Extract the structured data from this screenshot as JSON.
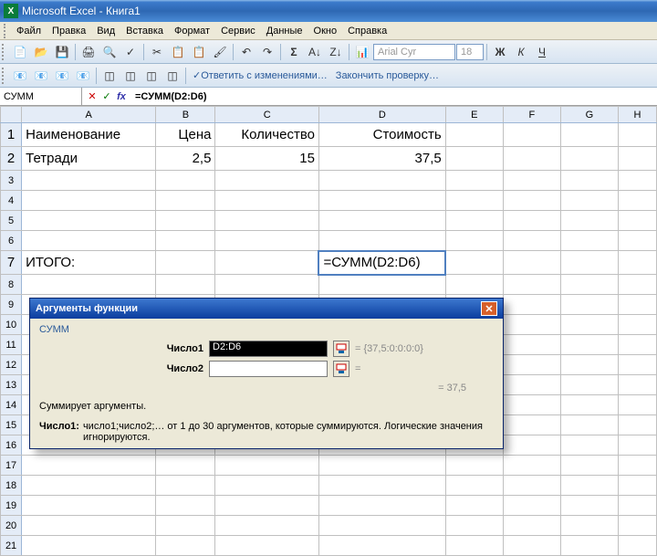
{
  "title": "Microsoft Excel - Книга1",
  "menu": {
    "file": "Файл",
    "edit": "Правка",
    "view": "Вид",
    "insert": "Вставка",
    "format": "Формат",
    "tools": "Сервис",
    "data": "Данные",
    "window": "Окно",
    "help": "Справка"
  },
  "toolbar2": {
    "font": "Arial Cyr",
    "size": "18",
    "review1": "Ответить с изменениями…",
    "review2": "Закончить проверку…"
  },
  "namebox": "СУММ",
  "formula": "=СУММ(D2:D6)",
  "columns": [
    "A",
    "B",
    "C",
    "D",
    "E",
    "F",
    "G",
    "H"
  ],
  "cells": {
    "A1": "Наименование",
    "B1": "Цена",
    "C1": "Количество",
    "D1": "Стоимость",
    "A2": "Тетради",
    "B2": "2,5",
    "C2": "15",
    "D2": "37,5",
    "A7": "ИТОГО:",
    "D7": "=СУММ(D2:D6)"
  },
  "dialog": {
    "title": "Аргументы функции",
    "func": "СУММ",
    "arg1_label": "Число1",
    "arg1_value": "D2:D6",
    "arg1_preview": "= {37,5:0:0:0:0}",
    "arg2_label": "Число2",
    "arg2_preview": "=",
    "result_label": "= 37,5",
    "desc": "Суммирует аргументы.",
    "hint_b": "Число1:",
    "hint": "число1;число2;… от 1 до 30 аргументов, которые суммируются. Логические значения игнорируются."
  },
  "chart_data": {
    "type": "table",
    "headers": [
      "Наименование",
      "Цена",
      "Количество",
      "Стоимость"
    ],
    "rows": [
      [
        "Тетради",
        2.5,
        15,
        37.5
      ]
    ],
    "total_row": {
      "label": "ИТОГО:",
      "formula": "=СУММ(D2:D6)",
      "value": 37.5
    }
  }
}
